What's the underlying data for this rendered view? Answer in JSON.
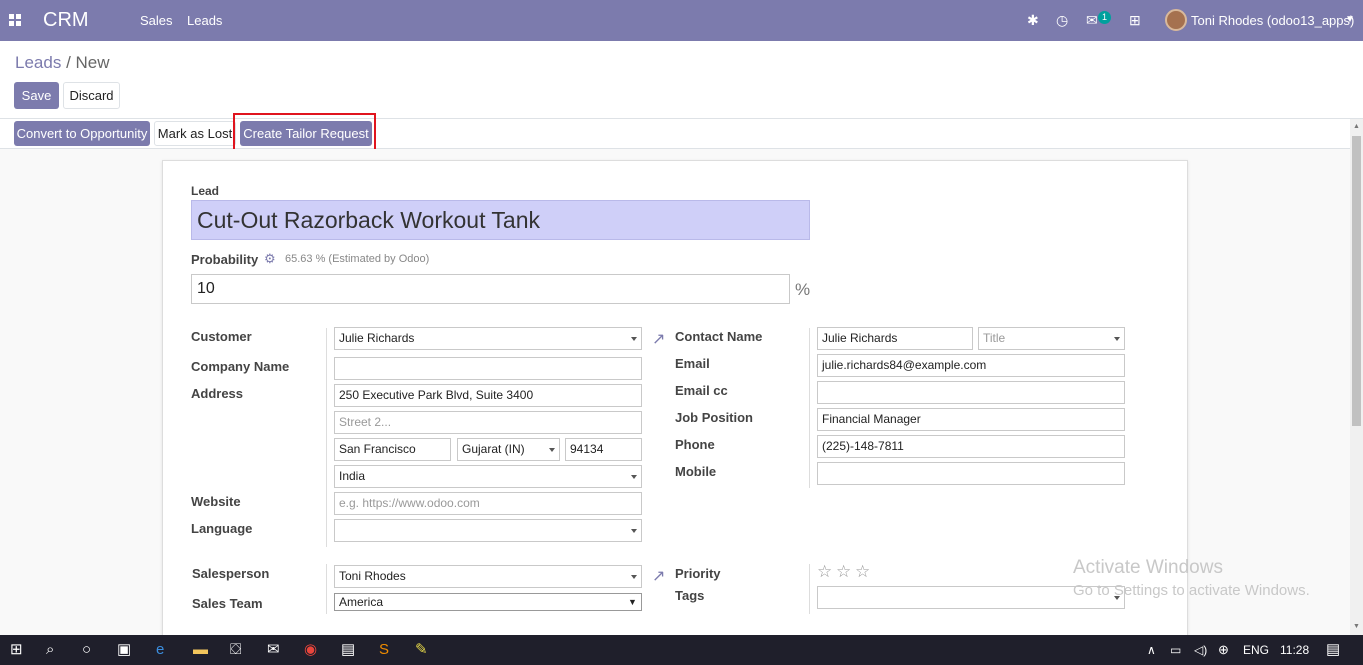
{
  "topbar": {
    "brand": "CRM",
    "menu": [
      "Sales",
      "Leads"
    ],
    "notification_count": "1",
    "user_name": "Toni Rhodes (odoo13_apps)",
    "color": "#7c7bad"
  },
  "breadcrumb": {
    "parent": "Leads",
    "separator": "/",
    "current": "New"
  },
  "buttons": {
    "save": "Save",
    "discard": "Discard",
    "convert": "Convert to Opportunity",
    "mark_lost": "Mark as Lost",
    "tailor": "Create Tailor Request"
  },
  "form": {
    "lead_label": "Lead",
    "lead_title": "Cut-Out Razorback Workout Tank",
    "probability_label": "Probability",
    "probability_estimate": "65.63 % (Estimated by Odoo)",
    "probability_value": "10",
    "percent": "%",
    "customer_label": "Customer",
    "customer": "Julie Richards",
    "company_label": "Company Name",
    "company": "",
    "address_label": "Address",
    "street": "250 Executive Park Blvd, Suite 3400",
    "street2_placeholder": "Street 2...",
    "city": "San Francisco",
    "state": "Gujarat (IN)",
    "zip": "94134",
    "country": "India",
    "website_label": "Website",
    "website_placeholder": "e.g. https://www.odoo.com",
    "language_label": "Language",
    "language": "",
    "contact_label": "Contact Name",
    "contact": "Julie Richards",
    "title_placeholder": "Title",
    "email_label": "Email",
    "email": "julie.richards84@example.com",
    "email_cc_label": "Email cc",
    "email_cc": "",
    "job_label": "Job Position",
    "job": "Financial Manager",
    "phone_label": "Phone",
    "phone": "(225)-148-7811",
    "mobile_label": "Mobile",
    "mobile": "",
    "salesperson_label": "Salesperson",
    "salesperson": "Toni Rhodes",
    "team_label": "Sales Team",
    "team": "America",
    "priority_label": "Priority",
    "priority_stars": 0,
    "tags_label": "Tags"
  },
  "watermark": {
    "line1": "Activate Windows",
    "line2": "Go to Settings to activate Windows."
  },
  "taskbar": {
    "lang": "ENG",
    "time": "11:28"
  }
}
